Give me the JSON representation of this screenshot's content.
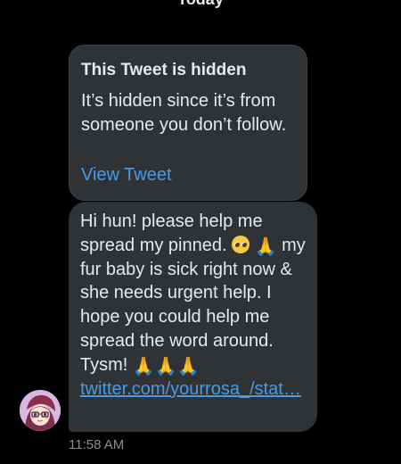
{
  "conversation": {
    "date_separator": "Today"
  },
  "hidden_tweet": {
    "title": "This Tweet is hidden",
    "body": "It’s hidden since it’s from someone you don’t follow.",
    "action_label": "View Tweet"
  },
  "message": {
    "line_1": "Hi hun! please help me",
    "line_2_start": "spread my pinned.",
    "line_2_emojis": [
      "pleading-face",
      "folded-hands"
    ],
    "lines_rest": "my fur baby is sick right now & she needs urgent help. I hope you could help me spread the word around. Tysm!",
    "trailing_emoji": "🙏🙏🙏",
    "link_text": "twitter.com/yourrosa_/stat…",
    "timestamp": "11:58 AM"
  },
  "sender": {
    "avatar_icon": "anime-avatar-icon"
  },
  "colors": {
    "background": "#000000",
    "bubble": "#2f3336",
    "link": "#4b9ae4",
    "text": "#e7e9ea",
    "muted": "#8b8f94"
  }
}
